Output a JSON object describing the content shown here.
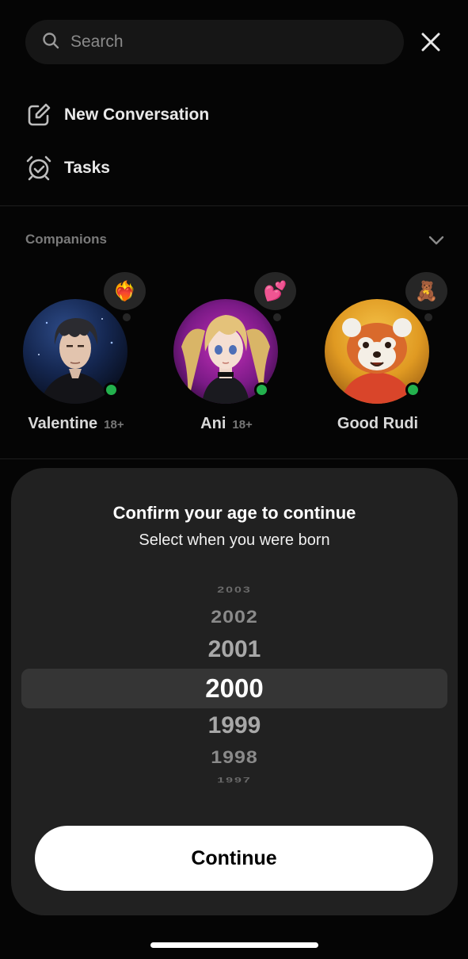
{
  "search": {
    "placeholder": "Search"
  },
  "menu": {
    "new_conversation": "New Conversation",
    "tasks": "Tasks"
  },
  "companions": {
    "title": "Companions",
    "items": [
      {
        "name": "Valentine",
        "age_tag": "18+",
        "emoji": "❤️‍🔥"
      },
      {
        "name": "Ani",
        "age_tag": "18+",
        "emoji": "💕"
      },
      {
        "name": "Good Rudi",
        "age_tag": "",
        "emoji": "🧸"
      }
    ]
  },
  "age_modal": {
    "title": "Confirm your age to continue",
    "subtitle": "Select when you were born",
    "years": [
      "2003",
      "2002",
      "2001",
      "2000",
      "1999",
      "1998",
      "1997"
    ],
    "selected_year": "2000",
    "continue_label": "Continue"
  },
  "colors": {
    "online": "#23b14d",
    "background": "#050505",
    "modal": "#212121"
  }
}
